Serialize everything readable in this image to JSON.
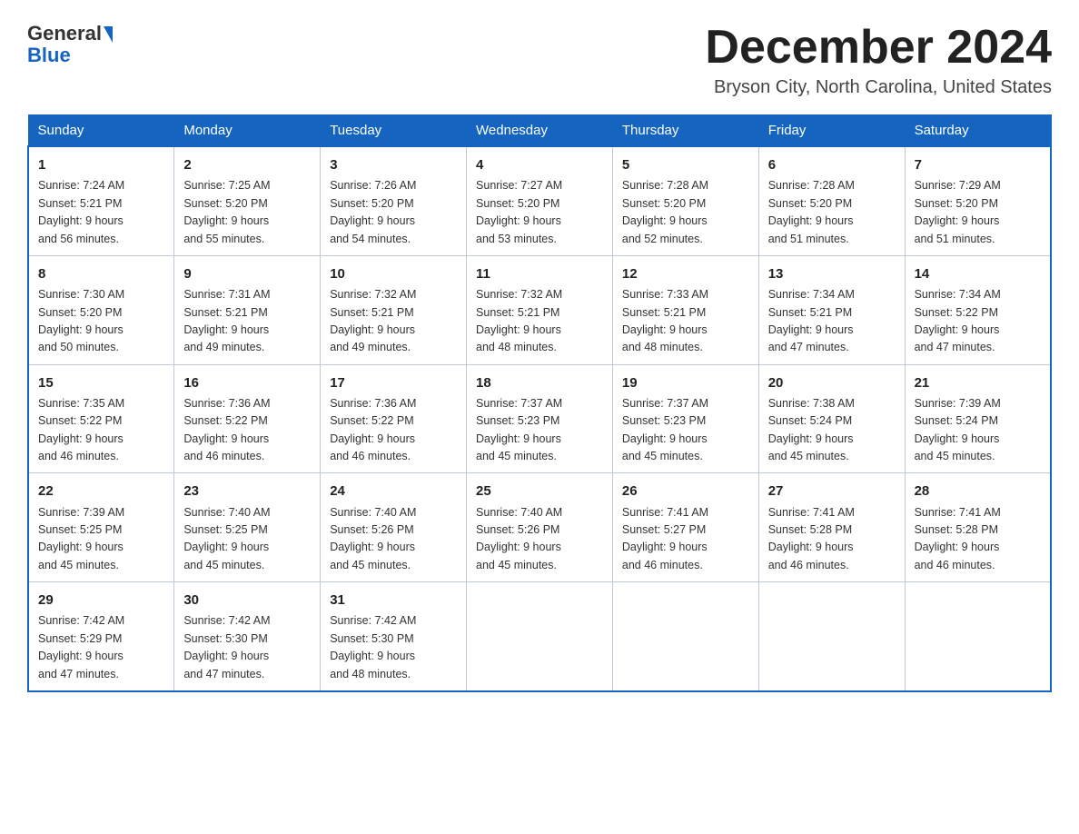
{
  "header": {
    "logo_general": "General",
    "logo_blue": "Blue",
    "month_title": "December 2024",
    "location": "Bryson City, North Carolina, United States"
  },
  "days_of_week": [
    "Sunday",
    "Monday",
    "Tuesday",
    "Wednesday",
    "Thursday",
    "Friday",
    "Saturday"
  ],
  "weeks": [
    [
      {
        "num": "1",
        "sunrise": "7:24 AM",
        "sunset": "5:21 PM",
        "daylight": "9 hours and 56 minutes."
      },
      {
        "num": "2",
        "sunrise": "7:25 AM",
        "sunset": "5:20 PM",
        "daylight": "9 hours and 55 minutes."
      },
      {
        "num": "3",
        "sunrise": "7:26 AM",
        "sunset": "5:20 PM",
        "daylight": "9 hours and 54 minutes."
      },
      {
        "num": "4",
        "sunrise": "7:27 AM",
        "sunset": "5:20 PM",
        "daylight": "9 hours and 53 minutes."
      },
      {
        "num": "5",
        "sunrise": "7:28 AM",
        "sunset": "5:20 PM",
        "daylight": "9 hours and 52 minutes."
      },
      {
        "num": "6",
        "sunrise": "7:28 AM",
        "sunset": "5:20 PM",
        "daylight": "9 hours and 51 minutes."
      },
      {
        "num": "7",
        "sunrise": "7:29 AM",
        "sunset": "5:20 PM",
        "daylight": "9 hours and 51 minutes."
      }
    ],
    [
      {
        "num": "8",
        "sunrise": "7:30 AM",
        "sunset": "5:20 PM",
        "daylight": "9 hours and 50 minutes."
      },
      {
        "num": "9",
        "sunrise": "7:31 AM",
        "sunset": "5:21 PM",
        "daylight": "9 hours and 49 minutes."
      },
      {
        "num": "10",
        "sunrise": "7:32 AM",
        "sunset": "5:21 PM",
        "daylight": "9 hours and 49 minutes."
      },
      {
        "num": "11",
        "sunrise": "7:32 AM",
        "sunset": "5:21 PM",
        "daylight": "9 hours and 48 minutes."
      },
      {
        "num": "12",
        "sunrise": "7:33 AM",
        "sunset": "5:21 PM",
        "daylight": "9 hours and 48 minutes."
      },
      {
        "num": "13",
        "sunrise": "7:34 AM",
        "sunset": "5:21 PM",
        "daylight": "9 hours and 47 minutes."
      },
      {
        "num": "14",
        "sunrise": "7:34 AM",
        "sunset": "5:22 PM",
        "daylight": "9 hours and 47 minutes."
      }
    ],
    [
      {
        "num": "15",
        "sunrise": "7:35 AM",
        "sunset": "5:22 PM",
        "daylight": "9 hours and 46 minutes."
      },
      {
        "num": "16",
        "sunrise": "7:36 AM",
        "sunset": "5:22 PM",
        "daylight": "9 hours and 46 minutes."
      },
      {
        "num": "17",
        "sunrise": "7:36 AM",
        "sunset": "5:22 PM",
        "daylight": "9 hours and 46 minutes."
      },
      {
        "num": "18",
        "sunrise": "7:37 AM",
        "sunset": "5:23 PM",
        "daylight": "9 hours and 45 minutes."
      },
      {
        "num": "19",
        "sunrise": "7:37 AM",
        "sunset": "5:23 PM",
        "daylight": "9 hours and 45 minutes."
      },
      {
        "num": "20",
        "sunrise": "7:38 AM",
        "sunset": "5:24 PM",
        "daylight": "9 hours and 45 minutes."
      },
      {
        "num": "21",
        "sunrise": "7:39 AM",
        "sunset": "5:24 PM",
        "daylight": "9 hours and 45 minutes."
      }
    ],
    [
      {
        "num": "22",
        "sunrise": "7:39 AM",
        "sunset": "5:25 PM",
        "daylight": "9 hours and 45 minutes."
      },
      {
        "num": "23",
        "sunrise": "7:40 AM",
        "sunset": "5:25 PM",
        "daylight": "9 hours and 45 minutes."
      },
      {
        "num": "24",
        "sunrise": "7:40 AM",
        "sunset": "5:26 PM",
        "daylight": "9 hours and 45 minutes."
      },
      {
        "num": "25",
        "sunrise": "7:40 AM",
        "sunset": "5:26 PM",
        "daylight": "9 hours and 45 minutes."
      },
      {
        "num": "26",
        "sunrise": "7:41 AM",
        "sunset": "5:27 PM",
        "daylight": "9 hours and 46 minutes."
      },
      {
        "num": "27",
        "sunrise": "7:41 AM",
        "sunset": "5:28 PM",
        "daylight": "9 hours and 46 minutes."
      },
      {
        "num": "28",
        "sunrise": "7:41 AM",
        "sunset": "5:28 PM",
        "daylight": "9 hours and 46 minutes."
      }
    ],
    [
      {
        "num": "29",
        "sunrise": "7:42 AM",
        "sunset": "5:29 PM",
        "daylight": "9 hours and 47 minutes."
      },
      {
        "num": "30",
        "sunrise": "7:42 AM",
        "sunset": "5:30 PM",
        "daylight": "9 hours and 47 minutes."
      },
      {
        "num": "31",
        "sunrise": "7:42 AM",
        "sunset": "5:30 PM",
        "daylight": "9 hours and 48 minutes."
      },
      null,
      null,
      null,
      null
    ]
  ],
  "labels": {
    "sunrise": "Sunrise:",
    "sunset": "Sunset:",
    "daylight": "Daylight:"
  }
}
